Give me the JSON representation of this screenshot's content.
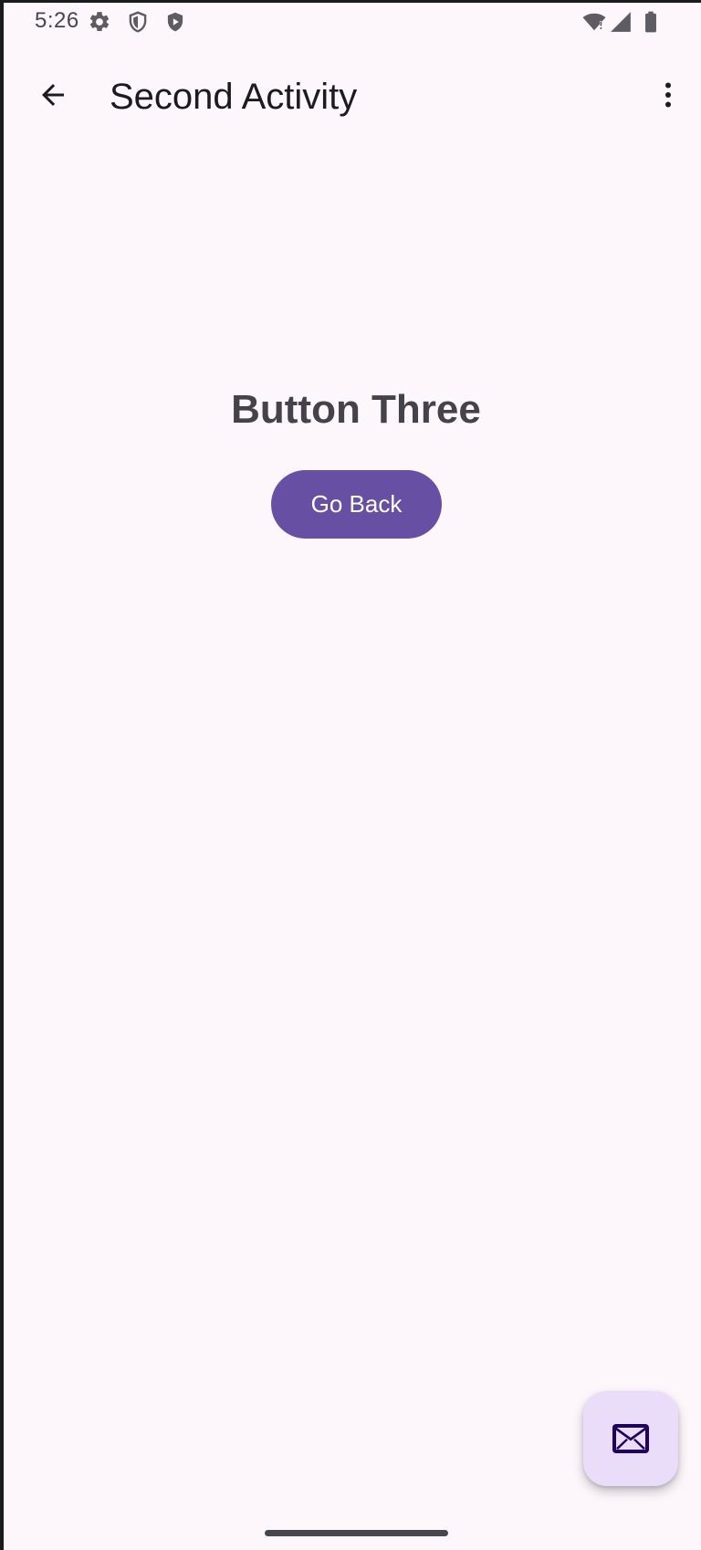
{
  "status_bar": {
    "time": "5:26",
    "icons": [
      "settings-gear-icon",
      "shield-icon",
      "play-shield-icon",
      "wifi-alert-icon",
      "cellular-signal-icon",
      "battery-icon"
    ]
  },
  "app_bar": {
    "title": "Second Activity",
    "nav_icon": "arrow-back-icon",
    "menu_icon": "more-vert-icon"
  },
  "content": {
    "heading": "Button Three",
    "go_back_label": "Go Back"
  },
  "fab": {
    "icon": "email-icon"
  },
  "colors": {
    "background": "#fdf7fc",
    "primary": "#6750a4",
    "on_primary": "#ffffff",
    "fab_container": "#e9ddf9",
    "fab_icon": "#21005d",
    "heading_text": "#45424a",
    "title_text": "#1d1b20"
  }
}
